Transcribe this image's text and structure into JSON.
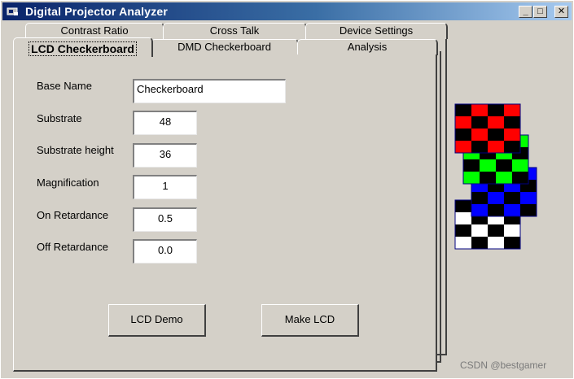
{
  "window": {
    "title": "Digital Projector Analyzer",
    "controls": {
      "minimize": "_",
      "maximize": "□",
      "close": "✕"
    }
  },
  "tabs": {
    "row_back": [
      "Contrast Ratio",
      "Cross Talk",
      "Device Settings"
    ],
    "row_front": [
      "LCD Checkerboard",
      "DMD Checkerboard",
      "Analysis"
    ],
    "active": "LCD Checkerboard"
  },
  "form": {
    "base_name": {
      "label": "Base Name",
      "value": "Checkerboard"
    },
    "substrate_width": {
      "label": "Substrate",
      "value": "48"
    },
    "substrate_height": {
      "label": "Substrate height",
      "value": "36"
    },
    "magnification": {
      "label": "Magnification",
      "value": "1"
    },
    "on_retardance": {
      "label": "On Retardance",
      "value": "0.5"
    },
    "off_retardance": {
      "label": "Off Retardance",
      "value": "0.0"
    }
  },
  "buttons": {
    "lcd_demo": "LCD Demo",
    "make_lcd": "Make LCD"
  },
  "checkerboards": {
    "colors": [
      "#ff0000",
      "#00ff00",
      "#0000ff",
      "#ffffff"
    ],
    "dark": "#000000"
  },
  "watermark": "CSDN @bestgamer"
}
